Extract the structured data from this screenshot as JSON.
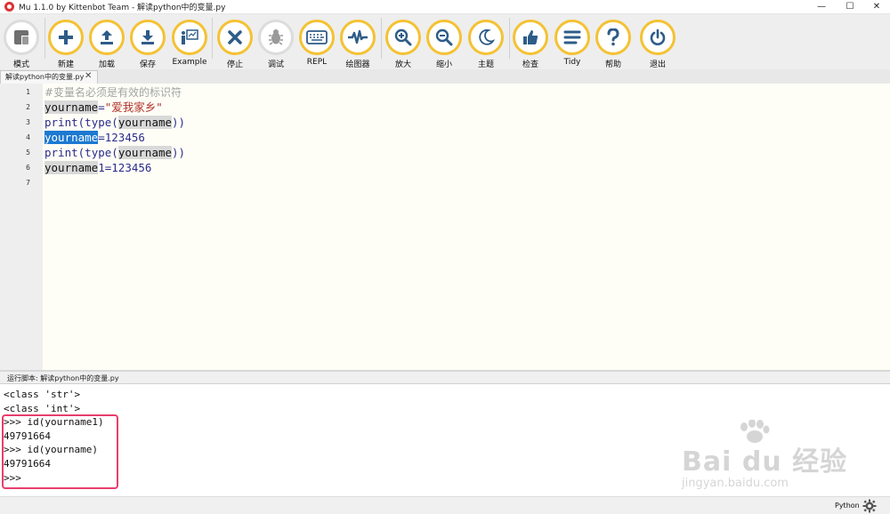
{
  "window": {
    "title": "Mu 1.1.0 by Kittenbot Team - 解读python中的变量.py",
    "controls": {
      "minimize": "—",
      "maximize": "☐",
      "close": "✕"
    }
  },
  "toolbar": {
    "accent_color": "#f4c233",
    "buttons": [
      {
        "id": "mode",
        "label": "模式",
        "icon": "mode-icon"
      },
      {
        "id": "new",
        "label": "新建",
        "icon": "plus-icon"
      },
      {
        "id": "load",
        "label": "加载",
        "icon": "upload-icon"
      },
      {
        "id": "save",
        "label": "保存",
        "icon": "download-icon"
      },
      {
        "id": "example",
        "label": "Example",
        "icon": "presentation-icon"
      },
      {
        "id": "stop",
        "label": "停止",
        "icon": "close-icon"
      },
      {
        "id": "debug",
        "label": "调试",
        "icon": "bug-icon"
      },
      {
        "id": "repl",
        "label": "REPL",
        "icon": "keyboard-icon"
      },
      {
        "id": "plotter",
        "label": "绘图器",
        "icon": "waveform-icon"
      },
      {
        "id": "zoom_in",
        "label": "放大",
        "icon": "zoom-in-icon"
      },
      {
        "id": "zoom_out",
        "label": "缩小",
        "icon": "zoom-out-icon"
      },
      {
        "id": "theme",
        "label": "主题",
        "icon": "moon-icon"
      },
      {
        "id": "check",
        "label": "检查",
        "icon": "thumbs-up-icon"
      },
      {
        "id": "tidy",
        "label": "Tidy",
        "icon": "lines-icon"
      },
      {
        "id": "help",
        "label": "帮助",
        "icon": "question-icon"
      },
      {
        "id": "quit",
        "label": "退出",
        "icon": "power-icon"
      }
    ]
  },
  "tabs": [
    {
      "label": "解读python中的变量.py",
      "close": "✕"
    }
  ],
  "editor": {
    "line_numbers": [
      "1",
      "2",
      "3",
      "4",
      "5",
      "6",
      "7"
    ],
    "lines": [
      {
        "tokens": [
          {
            "text": "#变量名必须是有效的标识符",
            "kind": "comment"
          }
        ]
      },
      {
        "tokens": [
          {
            "text": "yourname",
            "kind": "ident"
          },
          {
            "text": "=",
            "kind": "op"
          },
          {
            "text": "\"爱我家乡\"",
            "kind": "str"
          }
        ]
      },
      {
        "tokens": [
          {
            "text": "print",
            "kind": "fn"
          },
          {
            "text": "(",
            "kind": "op"
          },
          {
            "text": "type",
            "kind": "fn"
          },
          {
            "text": "(",
            "kind": "op"
          },
          {
            "text": "yourname",
            "kind": "ident"
          },
          {
            "text": "))",
            "kind": "op"
          }
        ]
      },
      {
        "tokens": [
          {
            "text": "yourname",
            "kind": "ident-sel"
          },
          {
            "text": "=",
            "kind": "op"
          },
          {
            "text": "123456",
            "kind": "num"
          }
        ]
      },
      {
        "tokens": [
          {
            "text": "print",
            "kind": "fn"
          },
          {
            "text": "(",
            "kind": "op"
          },
          {
            "text": "type",
            "kind": "fn"
          },
          {
            "text": "(",
            "kind": "op"
          },
          {
            "text": "yourname",
            "kind": "ident"
          },
          {
            "text": "))",
            "kind": "op"
          }
        ]
      },
      {
        "tokens": [
          {
            "text": "yourname",
            "kind": "ident"
          },
          {
            "text": "1=123456",
            "kind": "num"
          }
        ]
      },
      {
        "tokens": []
      }
    ]
  },
  "output_pane": {
    "header": "运行脚本: 解读python中的变量.py",
    "lines": [
      "<class 'str'>",
      "<class 'int'>",
      ">>> id(yourname1)",
      "49791664",
      ">>> id(yourname)",
      "49791664",
      ">>>"
    ],
    "highlight_color": "#e83e6c"
  },
  "watermark": {
    "brand": "Bai du 经验",
    "url": "jingyan.baidu.com"
  },
  "statusbar": {
    "mode": "Python",
    "settings_icon": "gear-icon"
  }
}
